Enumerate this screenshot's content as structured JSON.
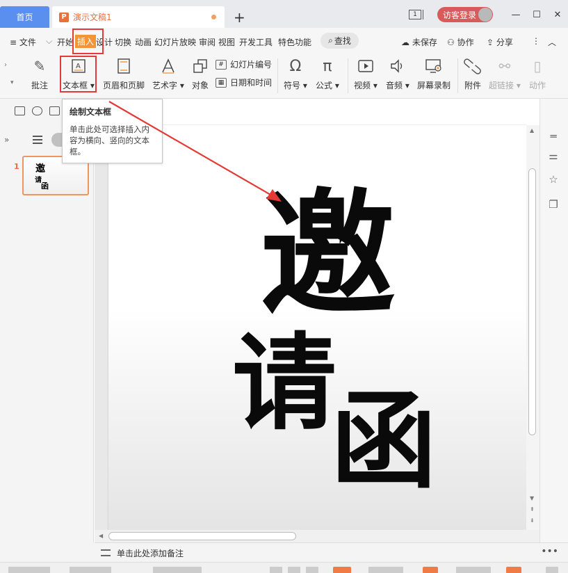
{
  "titlebar": {
    "home_tab": "首页",
    "doc_tab": "演示文稿1",
    "new_tab": "+",
    "window_count": "1",
    "login": "访客登录",
    "minimize": "—",
    "maximize": "☐",
    "close": "✕"
  },
  "menubar": {
    "file": "≡ 文件",
    "items": [
      "开始",
      "插入",
      "设计",
      "切换",
      "动画",
      "幻灯片放映",
      "审阅",
      "视图",
      "开发工具",
      "特色功能"
    ],
    "search": "查找",
    "unsaved": "未保存",
    "collab": "协作",
    "share": "分享"
  },
  "ribbon": {
    "comment": "批注",
    "textbox": "文本框",
    "header_footer": "页眉和页脚",
    "wordart": "艺术字",
    "object": "对象",
    "slide_number": "幻灯片编号",
    "datetime": "日期和时间",
    "symbol": "符号",
    "formula": "公式",
    "video": "视频",
    "audio": "音频",
    "screen_record": "屏幕录制",
    "attachment": "附件",
    "hyperlink": "超链接",
    "action": "动作"
  },
  "tooltip": {
    "title": "绘制文本框",
    "body": "单击此处可选择插入内容为横向、竖向的文本框。"
  },
  "slides_panel": {
    "slide_number": "1",
    "thumb_line1": "邀",
    "thumb_line2": "请",
    "thumb_line3": "函"
  },
  "slide": {
    "char1": "邀",
    "char2": "请",
    "char3": "函"
  },
  "notes": {
    "placeholder": "单击此处添加备注",
    "more": "•••"
  },
  "colors": {
    "accent": "#f29536",
    "home_tab": "#5a8ff0",
    "annotation": "#e53935",
    "login": "#d95a5a"
  }
}
